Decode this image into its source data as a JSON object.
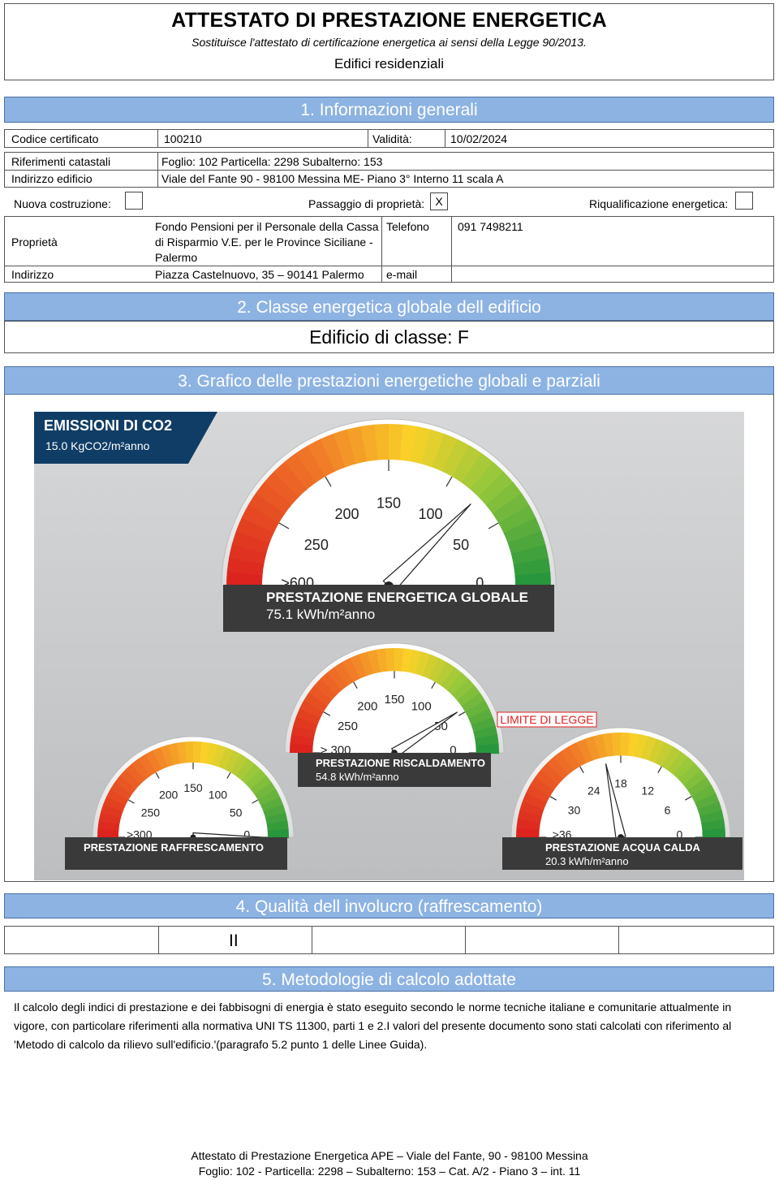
{
  "header": {
    "title": "ATTESTATO DI PRESTAZIONE ENERGETICA",
    "subtitle": "Sostituisce l'attestato di certificazione energetica ai sensi della Legge 90/2013.",
    "category": "Edifici residenziali"
  },
  "section1": {
    "title": "1. Informazioni generali",
    "codice_label": "Codice certificato",
    "codice_value": "100210",
    "validita_label": "Validità:",
    "validita_value": "10/02/2024",
    "rif_label": "Riferimenti catastali",
    "rif_value": "Foglio: 102 Particella: 2298 Subalterno: 153",
    "indirizzo_edificio_label": "Indirizzo edificio",
    "indirizzo_edificio_value": "Viale del Fante 90 - 98100 Messina ME- Piano 3° Interno 11 scala A",
    "nuova_label": "Nuova costruzione:",
    "nuova_value": "",
    "passaggio_label": "Passaggio di proprietà:",
    "passaggio_value": "X",
    "riqual_label": "Riqualificazione energetica:",
    "riqual_value": "",
    "proprieta_label": "Proprietà",
    "proprieta_line1": "Fondo Pensioni per il Personale della Cassa",
    "proprieta_line2": "di Risparmio V.E. per le Province Siciliane -",
    "proprieta_line3": "Palermo",
    "telefono_label": "Telefono",
    "telefono_value": "091 7498211",
    "indirizzo_label": "Indirizzo",
    "indirizzo_value": "Piazza Castelnuovo, 35 – 90141 Palermo",
    "email_label": "e-mail"
  },
  "section2": {
    "title": "2. Classe energetica globale dell edificio",
    "classe": "Edificio di classe: F"
  },
  "section3": {
    "title": "3. Grafico delle prestazioni energetiche globali e parziali",
    "co2_title": "EMISSIONI DI CO2",
    "co2_value": "15.0 KgCO2/m²anno",
    "limit_label": "LIMITE DI LEGGE",
    "gauges": [
      {
        "name": "PRESTAZIONE ENERGETICA GLOBALE",
        "value": 75.1,
        "value_text": "75.1 kWh/m²anno",
        "ticks": [
          ">600",
          "250",
          "200",
          "150",
          "100",
          "50",
          "0"
        ]
      },
      {
        "name": "PRESTAZIONE RISCALDAMENTO",
        "value": 54.8,
        "value_text": "54.8 kWh/m²anno",
        "ticks": [
          "> 300",
          "250",
          "200",
          "150",
          "100",
          "50",
          "0"
        ]
      },
      {
        "name": "PRESTAZIONE RAFFRESCAMENTO",
        "value": 0,
        "value_text": "",
        "ticks": [
          ">300",
          "250",
          "200",
          "150",
          "100",
          "50",
          "0"
        ]
      },
      {
        "name": "PRESTAZIONE ACQUA CALDA",
        "value": 20.3,
        "value_text": "20.3 kWh/m²anno",
        "ticks": [
          ">36",
          "30",
          "24",
          "18",
          "12",
          "6",
          "0"
        ]
      }
    ]
  },
  "section4": {
    "title": "4. Qualità dell involucro (raffrescamento)",
    "cells": [
      "",
      "II",
      "",
      "",
      ""
    ]
  },
  "section5": {
    "title": "5. Metodologie di calcolo adottate",
    "line1": "Il calcolo degli indici di prestazione e dei fabbisogni di energia è stato eseguito secondo le norme tecniche italiane e comunitarie attualmente in",
    "line2": "vigore, con particolare riferimenti alla normativa UNI TS 11300, parti 1 e 2.I valori del presente documento sono stati calcolati con riferimento al",
    "line3": "'Metodo di calcolo da rilievo sull'edificio.'(paragrafo 5.2 punto 1 delle Linee Guida)."
  },
  "footer": {
    "line1": "Attestato di Prestazione Energetica APE – Viale del Fante, 90 - 98100 Messina",
    "line2": "Foglio: 102 - Particella: 2298 – Subalterno: 153 – Cat. A/2 - Piano 3 – int. 11"
  },
  "colors": {
    "section_bg": "#8db3e2",
    "panel_bg": "#c7c9cb",
    "co2_bg": "#0f3d66",
    "limit_red": "#e02020"
  }
}
